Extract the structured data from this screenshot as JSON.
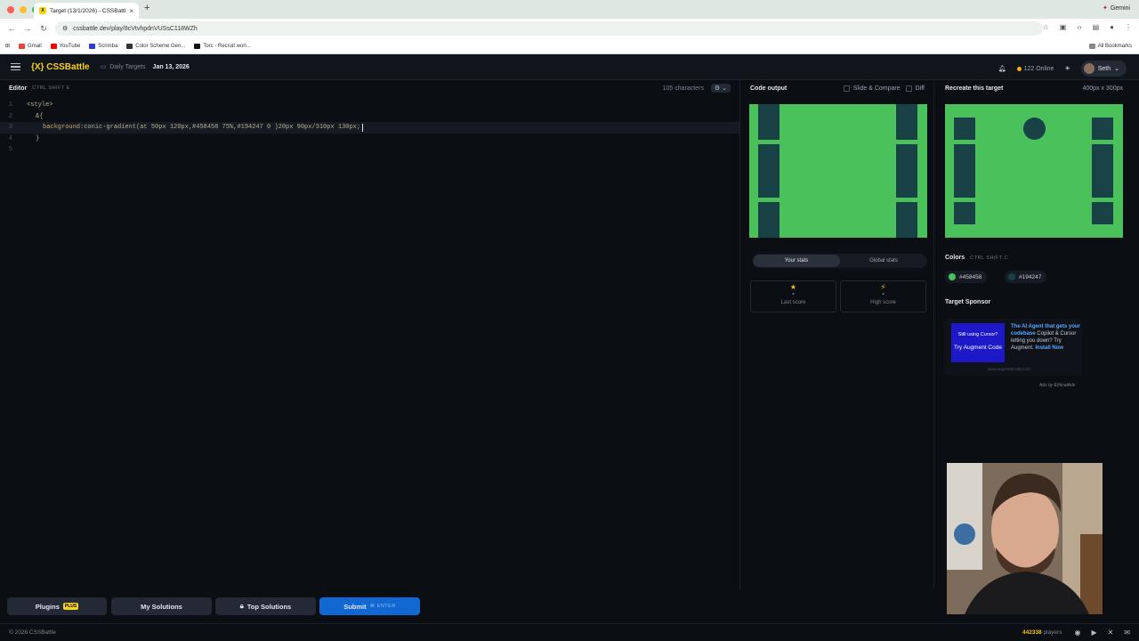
{
  "browser": {
    "tab_title": "Target (13/1/2026) - CSSBattl",
    "url": "cssbattle.dev/play/8cVtvhpdnVUSsC118WZh",
    "gemini": "Gemini",
    "bookmarks": [
      "Gmail",
      "YouTube",
      "Scrimba",
      "Color Scheme Gen...",
      "Torc - Recruit worl..."
    ],
    "all_bookmarks": "All Bookmarks"
  },
  "appbar": {
    "logo": "{X} CSSBattle",
    "crumb": "Daily Targets",
    "date": "Jan 13, 2026",
    "online": "122 Online",
    "user": "Seth"
  },
  "editor": {
    "title": "Editor",
    "shortcut": "CTRL  SHIFT  E",
    "chars": "105 characters",
    "lines": [
      {
        "num": "1",
        "text": "<style>"
      },
      {
        "num": "2",
        "text": "&{"
      },
      {
        "num": "3",
        "prop": "background",
        "value": ":conic-gradient(at 50px 120px,#458458 75%,#194247 0 )20px 90px/310px 130px;"
      },
      {
        "num": "4",
        "text": "}"
      },
      {
        "num": "5",
        "text": ""
      }
    ]
  },
  "output": {
    "title": "Code output",
    "slide": "Slide & Compare",
    "diff": "Diff",
    "tabs": [
      "Your stats",
      "Global stats"
    ],
    "last_label": "Last score",
    "high_label": "High score",
    "last_value": "-",
    "high_value": "-"
  },
  "target": {
    "title": "Recreate this target",
    "dims": "400px x 300px",
    "colors_title": "Colors",
    "colors_shortcut": "CTRL  SHIFT  C",
    "colors": [
      {
        "hex": "#458458",
        "swatch": "#45c25a"
      },
      {
        "hex": "#194247",
        "swatch": "#194247"
      }
    ],
    "sponsor_title": "Target Sponsor",
    "ad_img_line1": "Still using Cursor?",
    "ad_img_cta": "Try Augment Code",
    "ad_headline": "The AI Agent that gets your codebase",
    "ad_body": " Copilot & Cursor letting you down? Try Augment.",
    "ad_link": "Install Now",
    "ad_url": "www.augmentcode.com",
    "ads_by": "Ads by EthicalAds"
  },
  "bottom": {
    "plugins": "Plugins",
    "plus": "PLUS",
    "solutions": "My Solutions",
    "top": "Top Solutions",
    "submit": "Submit",
    "enter": "ENTER"
  },
  "footer": {
    "copyright": "© 2026 CSSBattle",
    "players_num": "442338",
    "players_label": " players"
  }
}
